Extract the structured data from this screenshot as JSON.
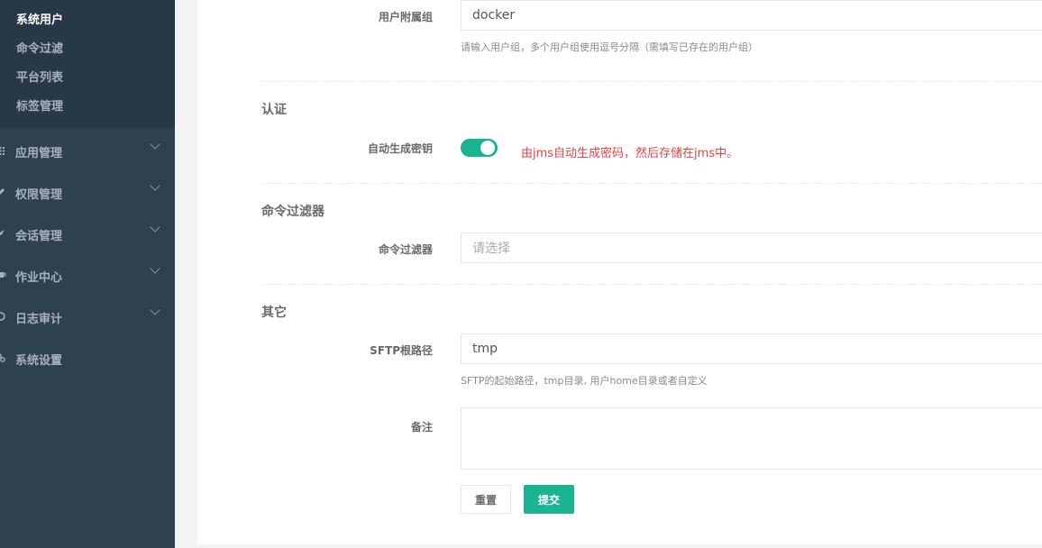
{
  "sidebar": {
    "submenu": [
      "系统用户",
      "命令过滤",
      "平台列表",
      "标签管理"
    ],
    "items": [
      {
        "label": "应用管理",
        "icon": "grid-icon"
      },
      {
        "label": "权限管理",
        "icon": "edit-icon"
      },
      {
        "label": "会话管理",
        "icon": "rocket-icon"
      },
      {
        "label": "作业中心",
        "icon": "coffee-icon"
      },
      {
        "label": "日志审计",
        "icon": "history-icon"
      },
      {
        "label": "系统设置",
        "icon": "gears-icon"
      }
    ]
  },
  "form": {
    "user_group": {
      "label": "用户附属组",
      "value": "docker",
      "help": "请输入用户组，多个用户组使用逗号分隔（需填写已存在的用户组）"
    },
    "auth": {
      "title": "认证",
      "auto_key_label": "自动生成密钥",
      "auto_key_on": true,
      "auto_key_note": "由jms自动生成密码，然后存储在jms中。"
    },
    "cmd_filter": {
      "title": "命令过滤器",
      "label": "命令过滤器",
      "placeholder": "请选择"
    },
    "other": {
      "title": "其它",
      "sftp_label": "SFTP根路径",
      "sftp_value": "tmp",
      "sftp_help": "SFTP的起始路径，tmp目录, 用户home目录或者自定义",
      "comment_label": "备注"
    },
    "buttons": {
      "reset": "重置",
      "submit": "提交"
    }
  },
  "colors": {
    "sidebar": "#2f4050",
    "submenu": "#293846",
    "primary": "#1ab394",
    "note": "#e64242"
  }
}
